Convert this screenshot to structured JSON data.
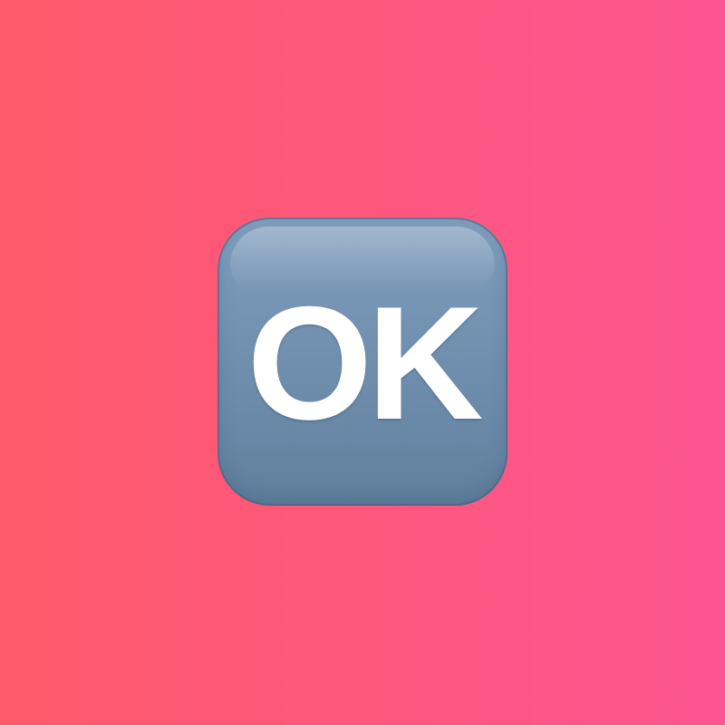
{
  "background": {
    "gradient_start": "#ff5a6a",
    "gradient_end": "#fc5591"
  },
  "ok_icon": {
    "label": "OK",
    "color_top": "#7f9dbd",
    "color_bottom": "#61809e",
    "text_color": "#ffffff"
  }
}
